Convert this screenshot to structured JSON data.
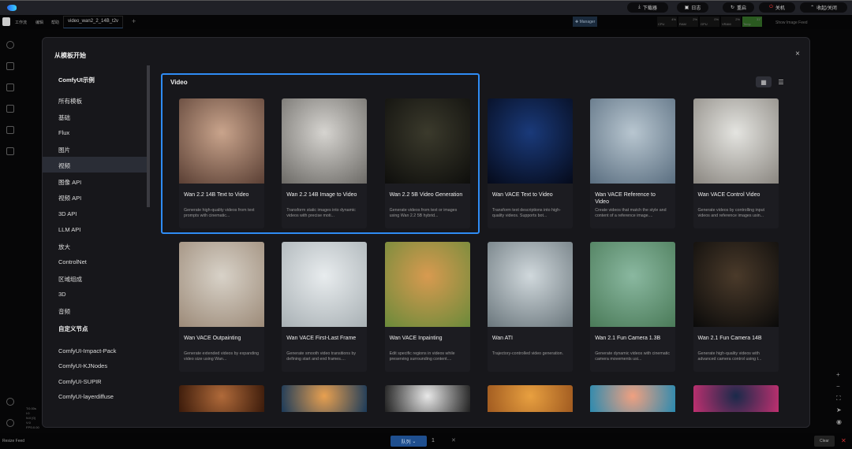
{
  "titlebar": {
    "buttons": [
      {
        "icon": "download-icon",
        "label": "下载器"
      },
      {
        "icon": "log-icon",
        "label": "日志"
      },
      {
        "icon": "restart-icon",
        "label": "重启"
      },
      {
        "icon": "power-icon",
        "label": "关机"
      },
      {
        "icon": "chevron-up-icon",
        "label": "收起/关闭"
      }
    ]
  },
  "menubar": {
    "items": [
      "工作流",
      "编辑",
      "帮助"
    ],
    "tab": "video_wan2_2_14B_t2v",
    "manager": "Manager",
    "monitors": [
      {
        "label": "CPU",
        "value": "4%"
      },
      {
        "label": "RAM",
        "value": "2%"
      },
      {
        "label": "GPU",
        "value": "0%"
      },
      {
        "label": "VRAM",
        "value": "2%"
      },
      {
        "label": "Temp",
        "value": "31°"
      }
    ],
    "image_feed": "Show Image Feed"
  },
  "modal": {
    "title": "从模板开始",
    "close": "×"
  },
  "sidebar": {
    "heading1": "ComfyUI示例",
    "items": [
      "所有模板",
      "基础",
      "Flux",
      "图片",
      "视频",
      "图像 API",
      "视频 API",
      "3D API",
      "LLM API",
      "放大",
      "ControlNet",
      "区域组成",
      "3D",
      "音频"
    ],
    "active": "视频",
    "heading2": "自定义节点",
    "custom": [
      "ComfyUI-Impact-Pack",
      "ComfyUI-KJNodes",
      "ComfyUI-SUPIR",
      "ComfyUI-layerdiffuse"
    ]
  },
  "content": {
    "title": "Video",
    "view_grid": "grid-icon",
    "view_list": "list-icon",
    "cards": [
      {
        "title": "Wan 2.2 14B Text to Video",
        "desc": "Generate high-quality videos from text prompts with cinematic...",
        "colors": [
          "#c9a48c",
          "#5a3f34"
        ]
      },
      {
        "title": "Wan 2.2 14B Image to Video",
        "desc": "Transform static images into dynamic videos with precise moti...",
        "colors": [
          "#d6d4d0",
          "#6c6a66"
        ]
      },
      {
        "title": "Wan 2.2 5B Video Generation",
        "desc": "Generate videos from text or images using Wan 2.2 5B hybrid...",
        "colors": [
          "#3b3a2c",
          "#0e0e0c"
        ]
      },
      {
        "title": "Wan VACE Text to Video",
        "desc": "Transform text descriptions into high-quality videos. Supports bot...",
        "colors": [
          "#1a3a7a",
          "#050a1a"
        ]
      },
      {
        "title": "Wan VACE Reference to Video",
        "desc": "Create videos that match the style and content of a reference image....",
        "colors": [
          "#b8c6d0",
          "#5a6e80"
        ]
      },
      {
        "title": "Wan VACE Control Video",
        "desc": "Generate videos by controlling input videos and reference images usin...",
        "colors": [
          "#e4e4e0",
          "#8a8680"
        ]
      },
      {
        "title": "Wan VACE Outpainting",
        "desc": "Generate extended videos by expanding video size using Wan...",
        "colors": [
          "#d8d2c8",
          "#9c8a78"
        ]
      },
      {
        "title": "Wan VACE First-Last Frame",
        "desc": "Generate smooth video transitions by defining start and end frames....",
        "colors": [
          "#e8ecee",
          "#a8b0b4"
        ]
      },
      {
        "title": "Wan VACE Inpainting",
        "desc": "Edit specific regions in videos while preserving surrounding content....",
        "colors": [
          "#d89a50",
          "#6a8a3a"
        ]
      },
      {
        "title": "Wan ATI",
        "desc": "Trajectory-controlled video generation.",
        "colors": [
          "#d0d8dc",
          "#6a767c"
        ]
      },
      {
        "title": "Wan 2.1 Fun Camera 1.3B",
        "desc": "Generate dynamic videos with cinematic camera movements usi...",
        "colors": [
          "#8ab8a0",
          "#4a7a58"
        ]
      },
      {
        "title": "Wan 2.1 Fun Camera 14B",
        "desc": "Generate high-quality videos with advanced camera control using t...",
        "colors": [
          "#4a3a2a",
          "#0a0a0a"
        ]
      },
      {
        "title": "",
        "desc": "",
        "colors": [
          "#b06a3a",
          "#3a1a0a"
        ]
      },
      {
        "title": "",
        "desc": "",
        "colors": [
          "#e8a050",
          "#1a3a5a"
        ]
      },
      {
        "title": "",
        "desc": "",
        "colors": [
          "#e8e8e8",
          "#202020"
        ]
      },
      {
        "title": "",
        "desc": "",
        "colors": [
          "#e8a040",
          "#a05a20"
        ]
      },
      {
        "title": "",
        "desc": "",
        "colors": [
          "#f0a080",
          "#2a8ab0"
        ]
      },
      {
        "title": "",
        "desc": "",
        "colors": [
          "#1a2a4a",
          "#c03070"
        ]
      }
    ]
  },
  "bottom": {
    "resize": "Resize Feed",
    "queue": "队列",
    "count": "1",
    "clear": "Clear"
  }
}
